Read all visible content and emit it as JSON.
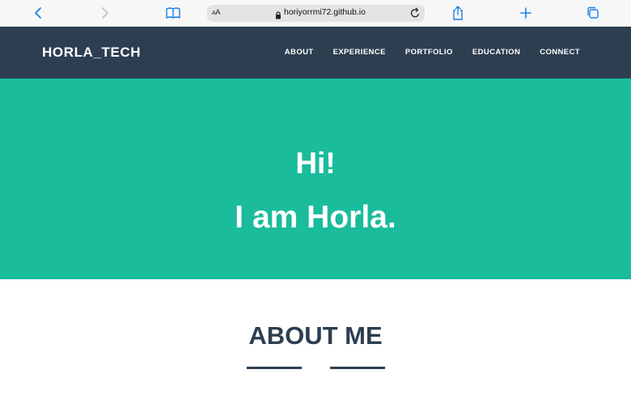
{
  "browser": {
    "text_size_label_small": "A",
    "text_size_label_large": "A",
    "url": "horiyorrmi72.github.io",
    "icons": [
      "back-icon",
      "forward-icon",
      "bookmarks-icon",
      "lock-icon",
      "reload-icon",
      "share-icon",
      "new-tab-icon",
      "tabs-icon"
    ],
    "accent_color": "#1a7ee6"
  },
  "navbar": {
    "brand": "HORLA_TECH",
    "links": [
      "ABOUT",
      "EXPERIENCE",
      "PORTFOLIO",
      "EDUCATION",
      "CONNECT"
    ],
    "background": "#2c3e50"
  },
  "hero": {
    "line1": "Hi!",
    "line2": "I am Horla.",
    "background": "#1abc9c"
  },
  "about": {
    "title": "ABOUT ME",
    "color": "#2c3e50"
  }
}
